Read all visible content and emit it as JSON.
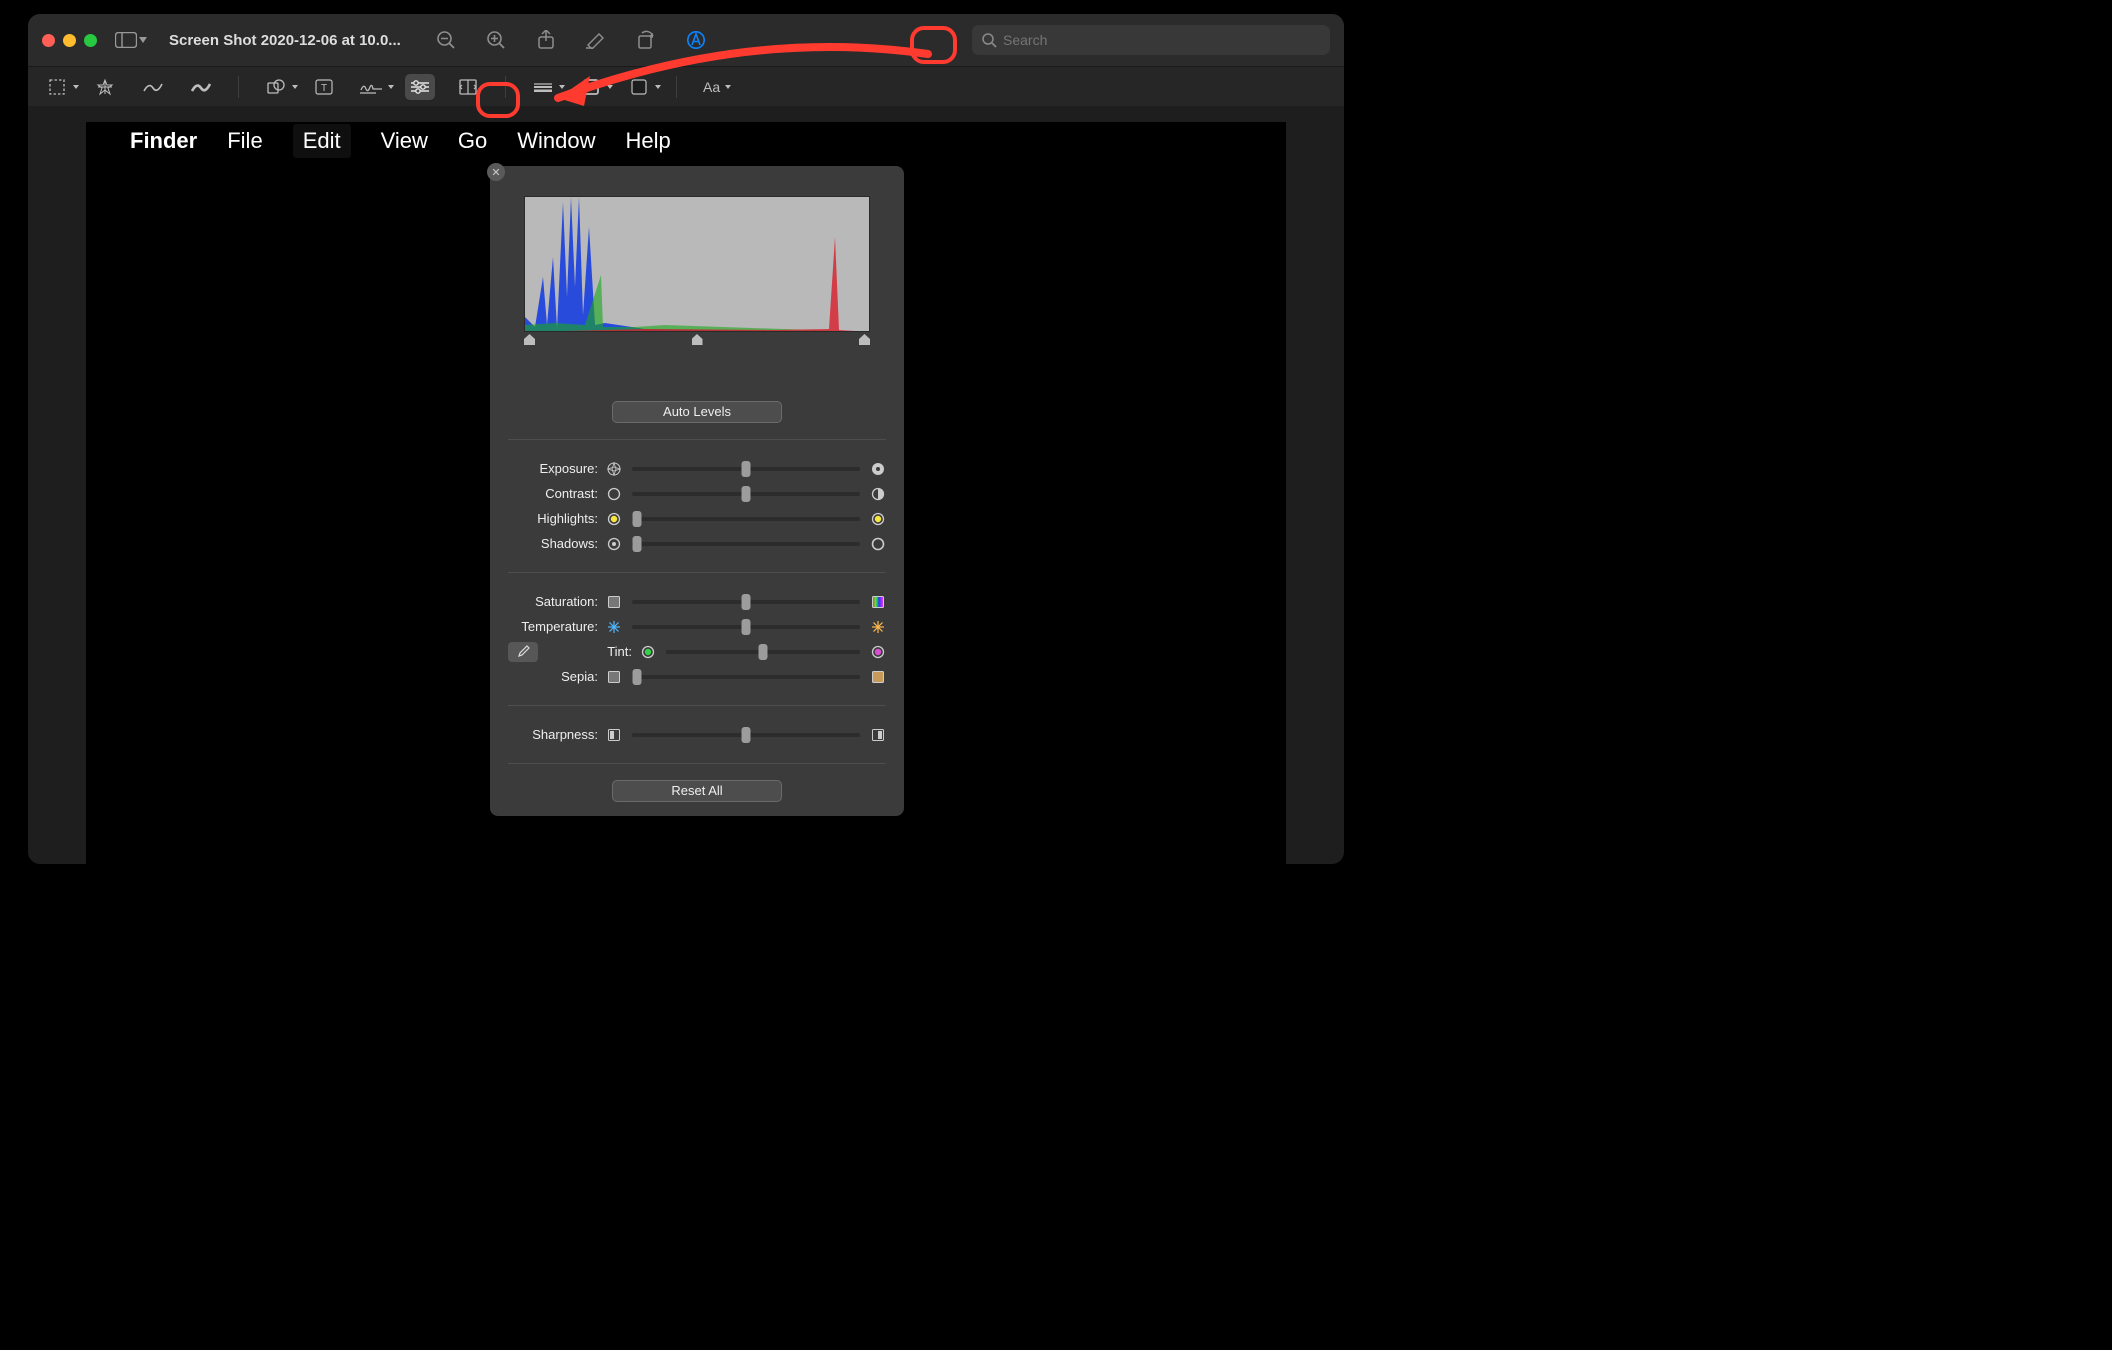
{
  "window": {
    "title": "Screen Shot 2020-12-06 at 10.0...",
    "search_placeholder": "Search"
  },
  "toolbar": {
    "sidebar": "Sidebar",
    "zoom_out": "Zoom Out",
    "zoom_in": "Zoom In",
    "share": "Share",
    "highlight": "Highlight",
    "rotate": "Rotate",
    "markup": "Markup"
  },
  "markup": {
    "select": "Selection",
    "instant_alpha": "Instant Alpha",
    "sketch": "Sketch",
    "draw": "Draw",
    "shapes": "Shapes",
    "text": "Text",
    "sign": "Sign",
    "adjust_color": "Adjust Color",
    "adjust_size": "Adjust Size",
    "shape_style": "Shape Style",
    "border_color": "Border Color",
    "fill_color": "Fill Color",
    "text_style": "Aa"
  },
  "menubar": {
    "app": "Finder",
    "items": [
      "File",
      "Edit",
      "View",
      "Go",
      "Window",
      "Help"
    ]
  },
  "adjust": {
    "auto_levels": "Auto Levels",
    "reset_all": "Reset All",
    "sliders": [
      {
        "label": "Exposure:",
        "value": 50,
        "icon_left": "aperture-open-icon",
        "icon_right": "aperture-closed-icon"
      },
      {
        "label": "Contrast:",
        "value": 50,
        "icon_left": "circle-empty-icon",
        "icon_right": "circle-half-icon"
      },
      {
        "label": "Highlights:",
        "value": 2,
        "icon_left": "dot-yellow-icon",
        "icon_right": "dot-yellow-icon"
      },
      {
        "label": "Shadows:",
        "value": 2,
        "icon_left": "target-icon",
        "icon_right": "ring-icon"
      }
    ],
    "sliders2": [
      {
        "label": "Saturation:",
        "value": 50,
        "icon_left": "square-grey-icon",
        "icon_right": "square-rainbow-icon"
      },
      {
        "label": "Temperature:",
        "value": 50,
        "icon_left": "snow-blue-icon",
        "icon_right": "snow-orange-icon"
      },
      {
        "label": "Tint:",
        "value": 50,
        "icon_left": "dot-green-icon",
        "icon_right": "dot-magenta-icon",
        "eyedrop": true
      },
      {
        "label": "Sepia:",
        "value": 2,
        "icon_left": "square-grey-icon",
        "icon_right": "square-sepia-icon"
      }
    ],
    "sliders3": [
      {
        "label": "Sharpness:",
        "value": 50,
        "icon_left": "square-blur-icon",
        "icon_right": "square-sharp-icon"
      }
    ]
  }
}
